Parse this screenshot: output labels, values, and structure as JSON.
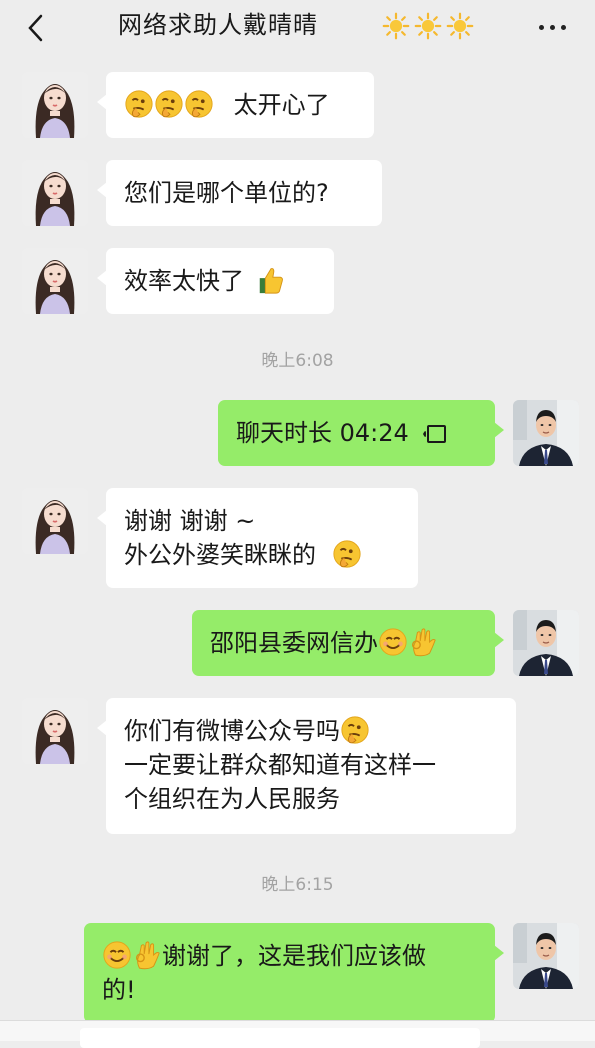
{
  "header": {
    "title": "网络求助人戴晴晴",
    "title_emoji": [
      "sun-emoji",
      "sun-emoji",
      "sun-emoji"
    ]
  },
  "messages": [
    {
      "side": "in",
      "text_after_emoji": "太开心了",
      "emoji_before": [
        "thinking-face-emoji",
        "thinking-face-emoji",
        "thinking-face-emoji"
      ]
    },
    {
      "side": "in",
      "text": "您们是哪个单位的?"
    },
    {
      "side": "in",
      "text": "效率太快了",
      "emoji_after": "thumbs-up-emoji"
    },
    {
      "side": "time",
      "text": "晚上6:08"
    },
    {
      "side": "out",
      "text": "聊天时长 04:24",
      "icon": "voice-call-icon"
    },
    {
      "side": "in",
      "lines": [
        "谢谢  谢谢 ~",
        "外公外婆笑眯眯的"
      ],
      "emoji_after": "thinking-face-emoji"
    },
    {
      "side": "out",
      "text": "邵阳县委网信办",
      "emoji_after": [
        "smiling-face-emoji",
        "ok-hand-emoji"
      ]
    },
    {
      "side": "in",
      "lines": [
        "你们有微博公众号吗",
        "一定要让群众都知道有这样一",
        "个组织在为人民服务"
      ],
      "emoji_after_line1": "thinking-face-emoji"
    },
    {
      "side": "time",
      "text": "晚上6:15"
    },
    {
      "side": "out",
      "lines": [
        "谢谢了，这是我们应该做",
        "的!"
      ],
      "emoji_before": [
        "smiling-face-emoji",
        "ok-hand-emoji"
      ]
    }
  ],
  "colors": {
    "background": "#ededed",
    "incoming_bubble": "#ffffff",
    "outgoing_bubble": "#95ec69",
    "timestamp": "#a3a3a3"
  }
}
